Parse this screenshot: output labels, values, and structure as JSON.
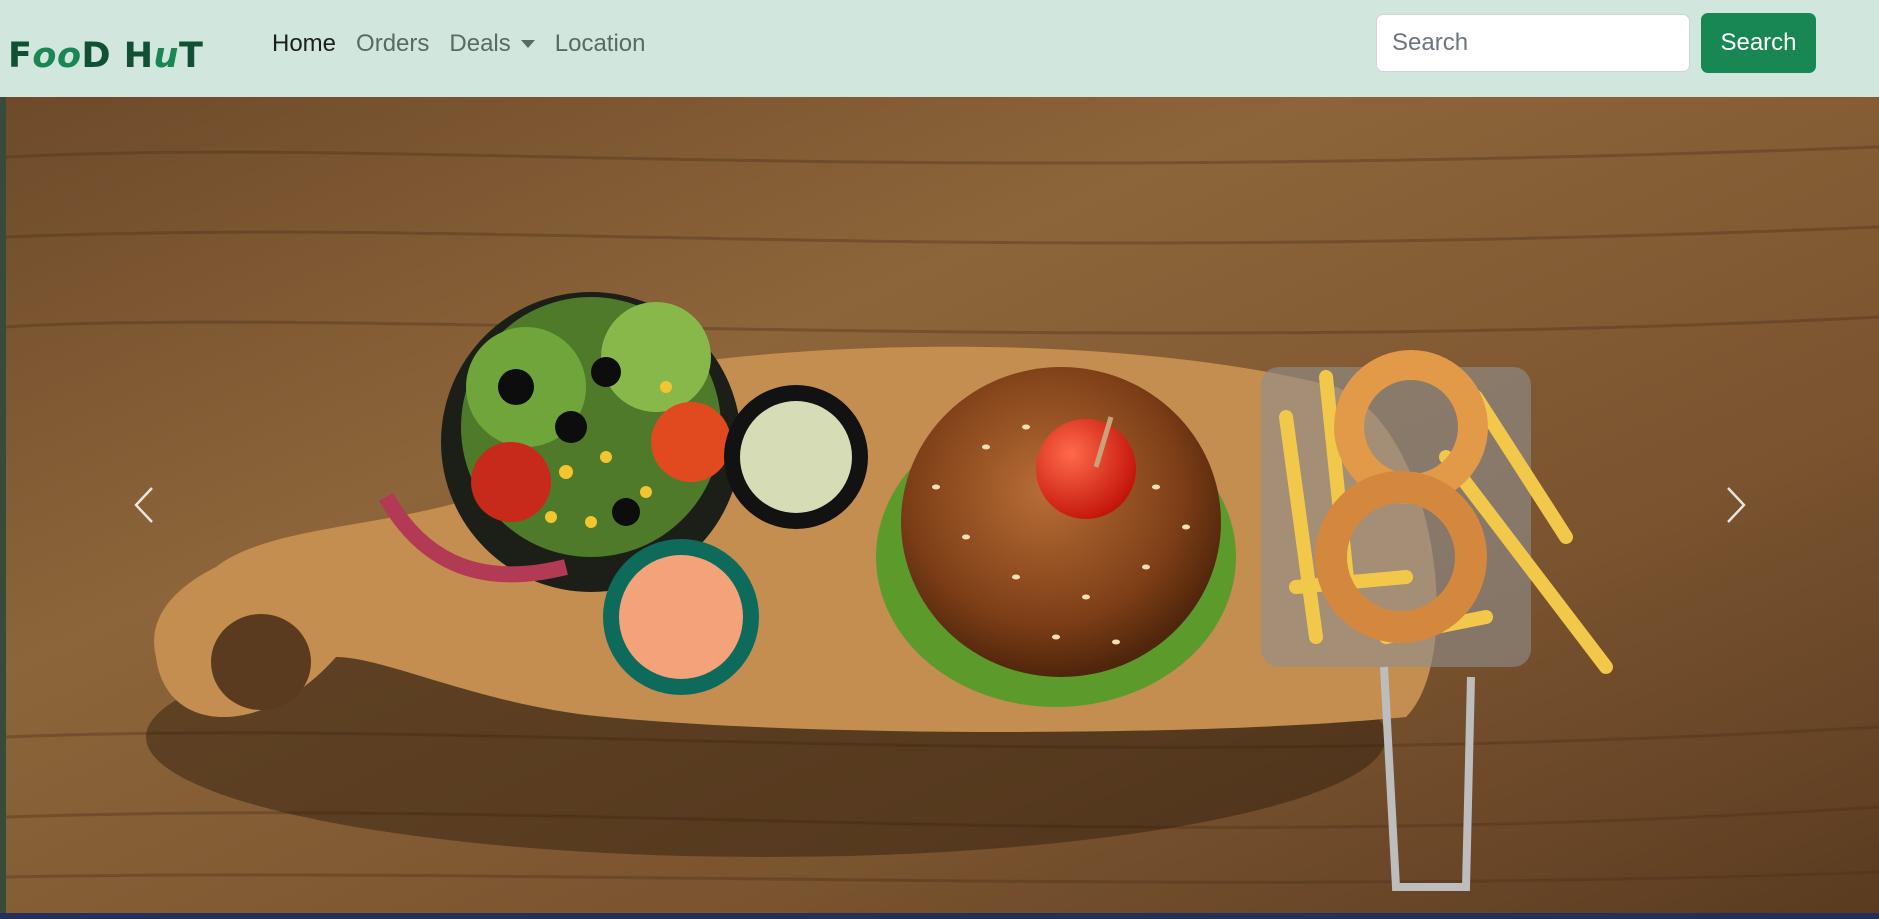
{
  "navbar": {
    "brand": {
      "part1": "F",
      "part2": "oo",
      "part3": "D H",
      "part4": "u",
      "part5": "T"
    },
    "links": [
      {
        "label": "Home",
        "active": true
      },
      {
        "label": "Orders",
        "active": false
      },
      {
        "label": "Deals",
        "active": false,
        "dropdown": true
      },
      {
        "label": "Location",
        "active": false
      }
    ],
    "search": {
      "placeholder": "Search",
      "value": "",
      "button_label": "Search"
    }
  },
  "carousel": {
    "image": "burger-salad-fries-board-photo",
    "prev_icon": "chevron-left-icon",
    "next_icon": "chevron-right-icon"
  },
  "colors": {
    "navbar_bg": "#d1e7dd",
    "brand": "#0f5132",
    "accent": "#198754",
    "wood": "#7a5632"
  }
}
